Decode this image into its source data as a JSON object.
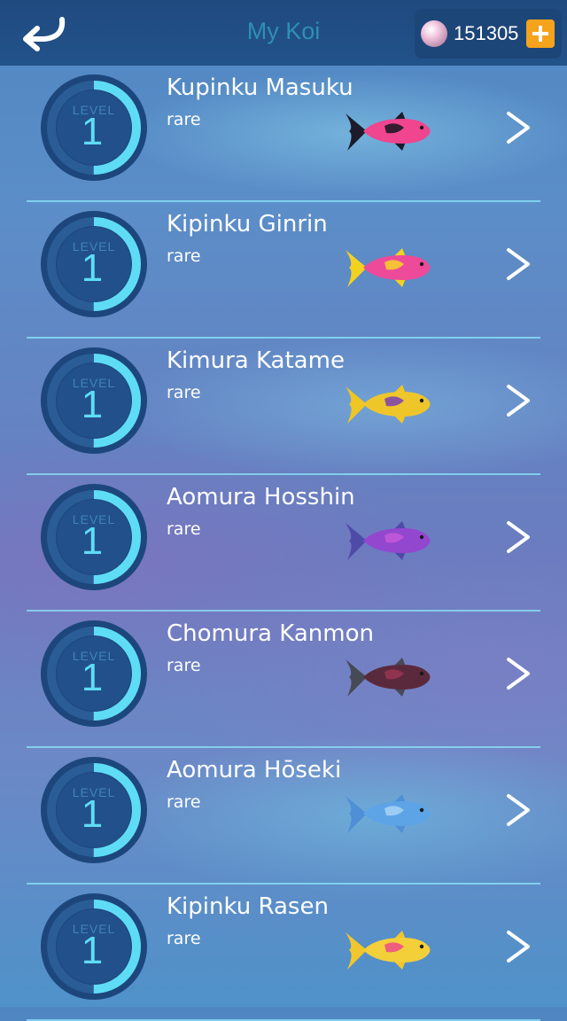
{
  "header": {
    "title": "My Koi",
    "back_icon": "back-arrow-icon",
    "coins": "151305",
    "currency_icon": "pearl-icon",
    "add_icon": "plus-icon"
  },
  "koi": [
    {
      "name": "Kupinku Masuku",
      "rarity": "rare",
      "level_label": "LEVEL",
      "level": "1",
      "level_progress": 0.5,
      "colors": {
        "body": "#f0458f",
        "tail": "#1b1b2b",
        "accent": "#151520"
      }
    },
    {
      "name": "Kipinku Ginrin",
      "rarity": "rare",
      "level_label": "LEVEL",
      "level": "1",
      "level_progress": 0.5,
      "colors": {
        "body": "#ee4a9a",
        "tail": "#f3d21f",
        "accent": "#f7d628"
      }
    },
    {
      "name": "Kimura Katame",
      "rarity": "rare",
      "level_label": "LEVEL",
      "level": "1",
      "level_progress": 0.5,
      "colors": {
        "body": "#efc62a",
        "tail": "#f0c624",
        "accent": "#7a3fb4"
      }
    },
    {
      "name": "Aomura Hosshin",
      "rarity": "rare",
      "level_label": "LEVEL",
      "level": "1",
      "level_progress": 0.5,
      "colors": {
        "body": "#9347cf",
        "tail": "#4f4aa8",
        "accent": "#c45ad8"
      }
    },
    {
      "name": "Chomura Kanmon",
      "rarity": "rare",
      "level_label": "LEVEL",
      "level": "1",
      "level_progress": 0.5,
      "colors": {
        "body": "#5a2a3c",
        "tail": "#454a55",
        "accent": "#9a3555"
      }
    },
    {
      "name": "Aomura Hōseki",
      "rarity": "rare",
      "level_label": "LEVEL",
      "level": "1",
      "level_progress": 0.5,
      "colors": {
        "body": "#5da4e6",
        "tail": "#4f8fd6",
        "accent": "#a8d4f5"
      }
    },
    {
      "name": "Kipinku Rasen",
      "rarity": "rare",
      "level_label": "LEVEL",
      "level": "1",
      "level_progress": 0.5,
      "colors": {
        "body": "#f3cf3a",
        "tail": "#f2c62c",
        "accent": "#ec4b8c"
      }
    }
  ],
  "colors": {
    "header_bg": "#22528a",
    "title": "#2f8fb6",
    "ring_bg": "#2a5c96",
    "ring_progress": "#5fdcf5",
    "divider": "#8ce6fa",
    "add_button": "#f5a31c"
  },
  "row_icons": {
    "chevron": "chevron-right-icon",
    "level": "level-ring"
  }
}
